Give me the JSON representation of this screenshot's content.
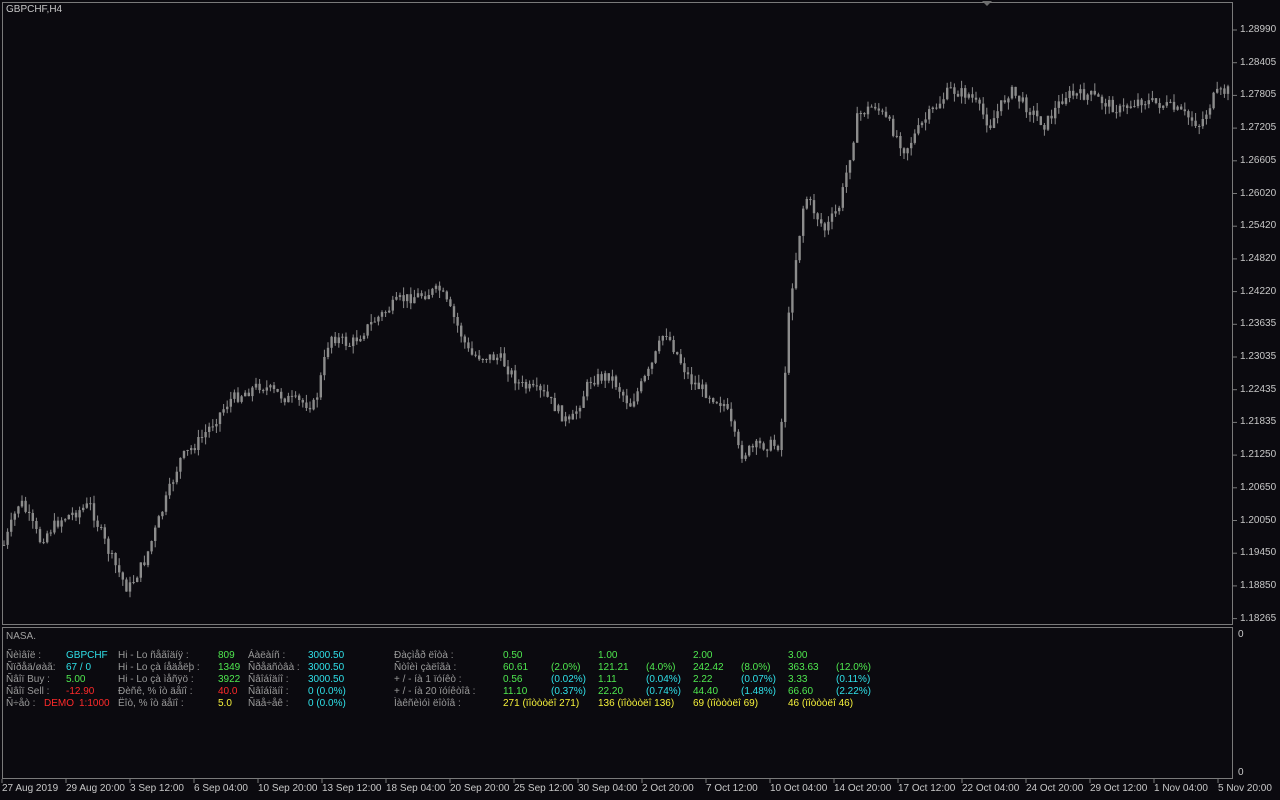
{
  "chart": {
    "title": "GBPCHF,H4",
    "colors": {
      "background": "#0b0a0f",
      "candle": "#8c8c8c",
      "frame": "#7a7a7a",
      "text": "#c8c8c8"
    },
    "price_axis": [
      "1.28990",
      "1.28405",
      "1.27805",
      "1.27205",
      "1.26605",
      "1.26020",
      "1.25420",
      "1.24820",
      "1.24220",
      "1.23635",
      "1.23035",
      "1.22435",
      "1.21835",
      "1.21250",
      "1.20650",
      "1.20050",
      "1.19450",
      "1.18850",
      "1.18265"
    ],
    "time_axis": [
      "27 Aug 2019",
      "29 Aug 20:00",
      "3 Sep 12:00",
      "6 Sep 04:00",
      "10 Sep 20:00",
      "13 Sep 12:00",
      "18 Sep 04:00",
      "20 Sep 20:00",
      "25 Sep 12:00",
      "30 Sep 04:00",
      "2 Oct 20:00",
      "7 Oct 12:00",
      "10 Oct 04:00",
      "14 Oct 20:00",
      "17 Oct 12:00",
      "22 Oct 04:00",
      "24 Oct 20:00",
      "29 Oct 12:00",
      "1 Nov 04:00",
      "5 Nov 20:00"
    ]
  },
  "indicator": {
    "name": "NASA.",
    "scale_top": "0",
    "scale_bottom": "0",
    "panel1": [
      {
        "label": "Ñèìâîë :",
        "value": "GBPCHF",
        "value2": ""
      },
      {
        "label": "Ñïðåä/øàã:",
        "value": "67 / 0",
        "value2": ""
      },
      {
        "label": "Ñâîï Buy :",
        "value": "5.00",
        "value2": ""
      },
      {
        "label": "Ñâîï Sell :",
        "value": "-12.90",
        "value2": ""
      },
      {
        "label": "Ñ÷åò :",
        "value": "DEMO",
        "value2": "1:1000"
      }
    ],
    "panel2": [
      {
        "label": "Hi - Lo ñåãîäíÿ :",
        "value": "809"
      },
      {
        "label": "Hi - Lo çà íåäåëþ :",
        "value": "1349"
      },
      {
        "label": "Hi - Lo çà ìåñÿö :",
        "value": "3922"
      },
      {
        "label": "Ðèñê, % îò äåïî :",
        "value": "40.0"
      },
      {
        "label": "Ëîò, % îò äåïî :",
        "value": "5.0"
      }
    ],
    "panel3": [
      {
        "label": "Áàëàíñ :",
        "value": "3000.50"
      },
      {
        "label": "Ñðåäñòâà :",
        "value": "3000.50"
      },
      {
        "label": "Ñâîáîäíî :",
        "value": "3000.50"
      },
      {
        "label": "Ñâîáîäíî :",
        "value": "0 (0.0%)"
      },
      {
        "label": "Ñäå÷åê :",
        "value": "0 (0.0%)"
      }
    ],
    "panel4": {
      "labels": [
        "Ðàçìåð ëîòà :",
        "Ñòîèì çàëîãà :",
        "+ / -  íà 1 ïóíêò :",
        "+ / -  íà 20 ïóíêòîâ :",
        "Ìàêñèìóì ëîòîâ :"
      ],
      "columns": [
        {
          "lot": "0.50",
          "margin": "60.61",
          "margin_pct": "(2.0%)",
          "pt1": "0.56",
          "pt1_pct": "(0.02%)",
          "pt20": "11.10",
          "pt20_pct": "(0.37%)",
          "max_lots": "271 (ïîòòòëî 271)"
        },
        {
          "lot": "1.00",
          "margin": "121.21",
          "margin_pct": "(4.0%)",
          "pt1": "1.11",
          "pt1_pct": "(0.04%)",
          "pt20": "22.20",
          "pt20_pct": "(0.74%)",
          "max_lots": "136 (ïîòòòëî 136)"
        },
        {
          "lot": "2.00",
          "margin": "242.42",
          "margin_pct": "(8.0%)",
          "pt1": "2.22",
          "pt1_pct": "(0.07%)",
          "pt20": "44.40",
          "pt20_pct": "(1.48%)",
          "max_lots": "69 (ïîòòòëî 69)"
        },
        {
          "lot": "3.00",
          "margin": "363.63",
          "margin_pct": "(12.0%)",
          "pt1": "3.33",
          "pt1_pct": "(0.11%)",
          "pt20": "66.60",
          "pt20_pct": "(2.22%)",
          "max_lots": "46 (ïîòòòëî 46)"
        }
      ]
    }
  }
}
